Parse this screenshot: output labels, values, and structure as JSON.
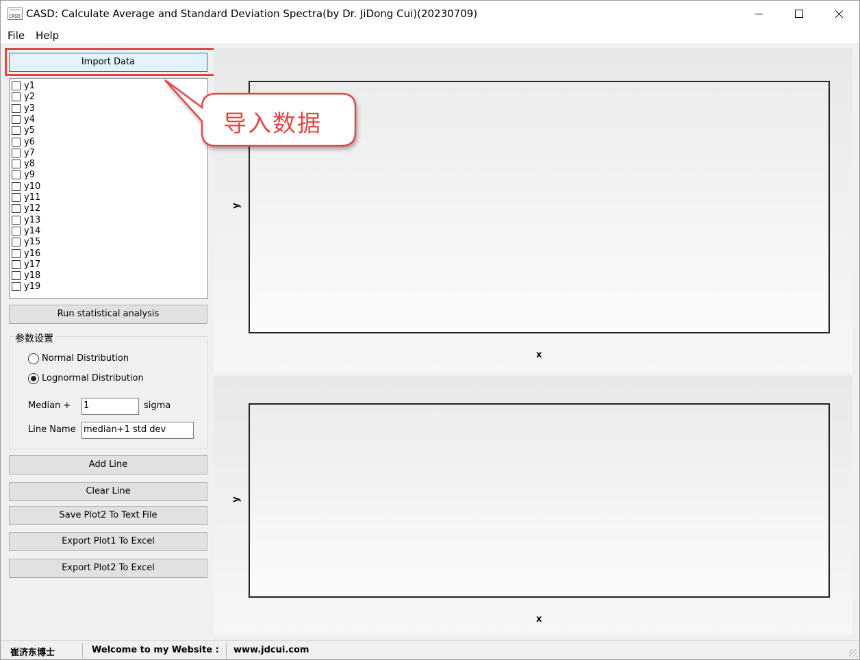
{
  "window": {
    "title": "CASD: Calculate Average and Standard Deviation Spectra(by Dr. JiDong Cui)(20230709)",
    "icon": "casd-app-icon",
    "icon_text": "CASD"
  },
  "menu": {
    "items": [
      "File",
      "Help"
    ]
  },
  "sidebar": {
    "import_label": "Import Data",
    "series": [
      "y1",
      "y2",
      "y3",
      "y4",
      "y5",
      "y6",
      "y7",
      "y8",
      "y9",
      "y10",
      "y11",
      "y12",
      "y13",
      "y14",
      "y15",
      "y16",
      "y17",
      "y18",
      "y19"
    ],
    "run_label": "Run statistical analysis",
    "params": {
      "group_title": "参数设置",
      "normal_label": "Normal Distribution",
      "lognormal_label": "Lognormal Distribution",
      "selected_distribution": "Lognormal Distribution",
      "median_label": "Median  +",
      "median_value": "1",
      "sigma_label": "sigma",
      "line_name_label": "Line Name",
      "line_name_value": "median+1 std dev"
    },
    "buttons": {
      "add_line": "Add Line",
      "clear_line": "Clear Line",
      "save_plot2": "Save Plot2 To Text File",
      "export_plot1": "Export Plot1 To Excel",
      "export_plot2": "Export Plot2 To Excel"
    }
  },
  "callout": {
    "text": "导入数据",
    "color": "#e04848"
  },
  "plot1": {
    "xlabel": "x",
    "ylabel": "y"
  },
  "plot2": {
    "xlabel": "x",
    "ylabel": "y"
  },
  "status": {
    "author": "崔济东博士",
    "welcome": "Welcome to my Website :",
    "url": "www.jdcui.com"
  }
}
